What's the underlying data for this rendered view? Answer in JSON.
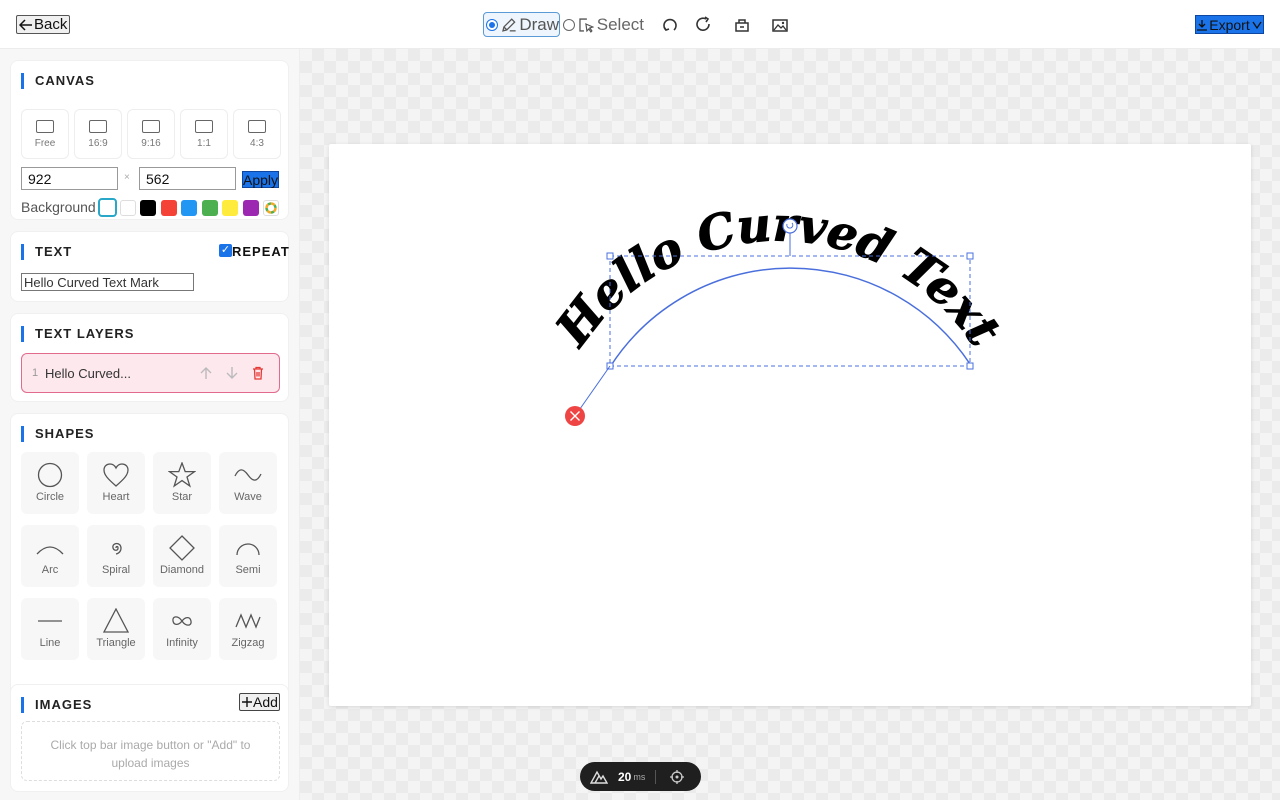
{
  "topbar": {
    "back_label": "Back",
    "mode_draw": "Draw",
    "mode_select": "Select",
    "active_mode": "Draw",
    "export_label": "Export",
    "tools": [
      "undo-icon",
      "redo-icon",
      "eraser-icon",
      "image-icon"
    ]
  },
  "sidebar": {
    "canvas": {
      "title": "CANVAS",
      "ratios": [
        "Free",
        "16:9",
        "9:16",
        "1:1",
        "4:3"
      ],
      "width": "922",
      "height": "562",
      "times": "×",
      "apply_label": "Apply",
      "background_label": "Background",
      "colors": [
        "#ffffff",
        "#ffffff",
        "#000000",
        "#f44336",
        "#2196f3",
        "#4caf50",
        "#ffeb3b",
        "#9c27b0"
      ]
    },
    "text": {
      "title": "TEXT",
      "repeat_label": "REPEAT",
      "repeat_checked": true,
      "value": "Hello Curved Text Mark"
    },
    "layers": {
      "title": "TEXT LAYERS",
      "items": [
        {
          "index": "1",
          "name": "Hello Curved..."
        }
      ]
    },
    "shapes": {
      "title": "SHAPES",
      "items": [
        "Circle",
        "Heart",
        "Star",
        "Wave",
        "Arc",
        "Spiral",
        "Diamond",
        "Semi",
        "Line",
        "Triangle",
        "Infinity",
        "Zigzag"
      ]
    },
    "images": {
      "title": "IMAGES",
      "add_label": "Add",
      "hint": "Click top bar image button or \"Add\" to upload images"
    }
  },
  "canvas_text": "Hello Curved Text",
  "status": {
    "value": "20",
    "unit": "ms"
  },
  "colors": {
    "accent": "#1a73e8",
    "selection": "#4a6fdc",
    "delete": "#ef4444"
  }
}
